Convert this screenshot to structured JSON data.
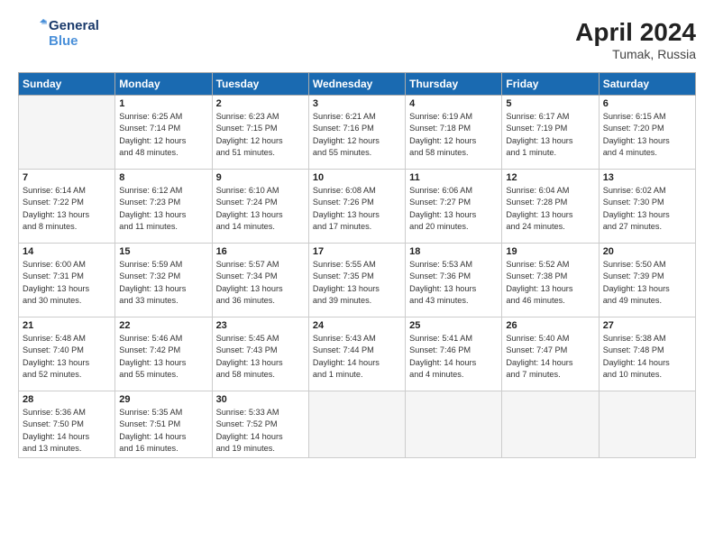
{
  "header": {
    "logo_line1": "General",
    "logo_line2": "Blue",
    "month_year": "April 2024",
    "location": "Tumak, Russia"
  },
  "days_of_week": [
    "Sunday",
    "Monday",
    "Tuesday",
    "Wednesday",
    "Thursday",
    "Friday",
    "Saturday"
  ],
  "weeks": [
    [
      {
        "day": "",
        "info": ""
      },
      {
        "day": "1",
        "info": "Sunrise: 6:25 AM\nSunset: 7:14 PM\nDaylight: 12 hours\nand 48 minutes."
      },
      {
        "day": "2",
        "info": "Sunrise: 6:23 AM\nSunset: 7:15 PM\nDaylight: 12 hours\nand 51 minutes."
      },
      {
        "day": "3",
        "info": "Sunrise: 6:21 AM\nSunset: 7:16 PM\nDaylight: 12 hours\nand 55 minutes."
      },
      {
        "day": "4",
        "info": "Sunrise: 6:19 AM\nSunset: 7:18 PM\nDaylight: 12 hours\nand 58 minutes."
      },
      {
        "day": "5",
        "info": "Sunrise: 6:17 AM\nSunset: 7:19 PM\nDaylight: 13 hours\nand 1 minute."
      },
      {
        "day": "6",
        "info": "Sunrise: 6:15 AM\nSunset: 7:20 PM\nDaylight: 13 hours\nand 4 minutes."
      }
    ],
    [
      {
        "day": "7",
        "info": "Sunrise: 6:14 AM\nSunset: 7:22 PM\nDaylight: 13 hours\nand 8 minutes."
      },
      {
        "day": "8",
        "info": "Sunrise: 6:12 AM\nSunset: 7:23 PM\nDaylight: 13 hours\nand 11 minutes."
      },
      {
        "day": "9",
        "info": "Sunrise: 6:10 AM\nSunset: 7:24 PM\nDaylight: 13 hours\nand 14 minutes."
      },
      {
        "day": "10",
        "info": "Sunrise: 6:08 AM\nSunset: 7:26 PM\nDaylight: 13 hours\nand 17 minutes."
      },
      {
        "day": "11",
        "info": "Sunrise: 6:06 AM\nSunset: 7:27 PM\nDaylight: 13 hours\nand 20 minutes."
      },
      {
        "day": "12",
        "info": "Sunrise: 6:04 AM\nSunset: 7:28 PM\nDaylight: 13 hours\nand 24 minutes."
      },
      {
        "day": "13",
        "info": "Sunrise: 6:02 AM\nSunset: 7:30 PM\nDaylight: 13 hours\nand 27 minutes."
      }
    ],
    [
      {
        "day": "14",
        "info": "Sunrise: 6:00 AM\nSunset: 7:31 PM\nDaylight: 13 hours\nand 30 minutes."
      },
      {
        "day": "15",
        "info": "Sunrise: 5:59 AM\nSunset: 7:32 PM\nDaylight: 13 hours\nand 33 minutes."
      },
      {
        "day": "16",
        "info": "Sunrise: 5:57 AM\nSunset: 7:34 PM\nDaylight: 13 hours\nand 36 minutes."
      },
      {
        "day": "17",
        "info": "Sunrise: 5:55 AM\nSunset: 7:35 PM\nDaylight: 13 hours\nand 39 minutes."
      },
      {
        "day": "18",
        "info": "Sunrise: 5:53 AM\nSunset: 7:36 PM\nDaylight: 13 hours\nand 43 minutes."
      },
      {
        "day": "19",
        "info": "Sunrise: 5:52 AM\nSunset: 7:38 PM\nDaylight: 13 hours\nand 46 minutes."
      },
      {
        "day": "20",
        "info": "Sunrise: 5:50 AM\nSunset: 7:39 PM\nDaylight: 13 hours\nand 49 minutes."
      }
    ],
    [
      {
        "day": "21",
        "info": "Sunrise: 5:48 AM\nSunset: 7:40 PM\nDaylight: 13 hours\nand 52 minutes."
      },
      {
        "day": "22",
        "info": "Sunrise: 5:46 AM\nSunset: 7:42 PM\nDaylight: 13 hours\nand 55 minutes."
      },
      {
        "day": "23",
        "info": "Sunrise: 5:45 AM\nSunset: 7:43 PM\nDaylight: 13 hours\nand 58 minutes."
      },
      {
        "day": "24",
        "info": "Sunrise: 5:43 AM\nSunset: 7:44 PM\nDaylight: 14 hours\nand 1 minute."
      },
      {
        "day": "25",
        "info": "Sunrise: 5:41 AM\nSunset: 7:46 PM\nDaylight: 14 hours\nand 4 minutes."
      },
      {
        "day": "26",
        "info": "Sunrise: 5:40 AM\nSunset: 7:47 PM\nDaylight: 14 hours\nand 7 minutes."
      },
      {
        "day": "27",
        "info": "Sunrise: 5:38 AM\nSunset: 7:48 PM\nDaylight: 14 hours\nand 10 minutes."
      }
    ],
    [
      {
        "day": "28",
        "info": "Sunrise: 5:36 AM\nSunset: 7:50 PM\nDaylight: 14 hours\nand 13 minutes."
      },
      {
        "day": "29",
        "info": "Sunrise: 5:35 AM\nSunset: 7:51 PM\nDaylight: 14 hours\nand 16 minutes."
      },
      {
        "day": "30",
        "info": "Sunrise: 5:33 AM\nSunset: 7:52 PM\nDaylight: 14 hours\nand 19 minutes."
      },
      {
        "day": "",
        "info": ""
      },
      {
        "day": "",
        "info": ""
      },
      {
        "day": "",
        "info": ""
      },
      {
        "day": "",
        "info": ""
      }
    ]
  ]
}
